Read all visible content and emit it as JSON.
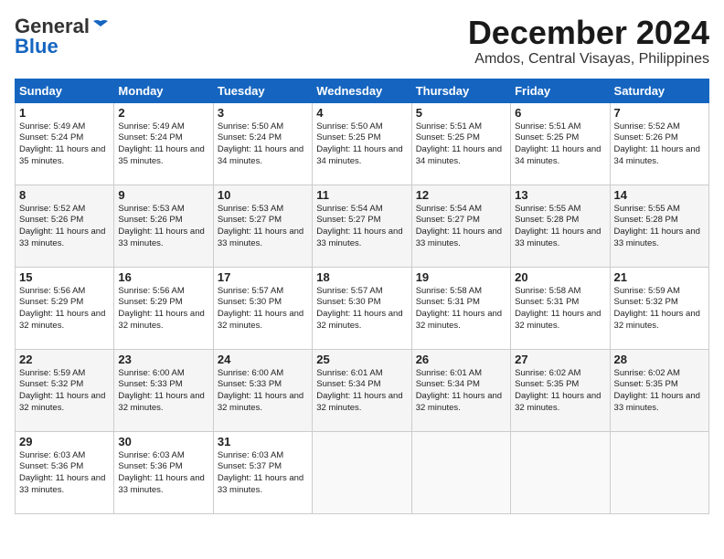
{
  "logo": {
    "line1": "General",
    "line2": "Blue"
  },
  "title": "December 2024",
  "location": "Amdos, Central Visayas, Philippines",
  "days_of_week": [
    "Sunday",
    "Monday",
    "Tuesday",
    "Wednesday",
    "Thursday",
    "Friday",
    "Saturday"
  ],
  "weeks": [
    [
      {
        "day": "1",
        "sunrise": "5:49 AM",
        "sunset": "5:24 PM",
        "daylight": "11 hours and 35 minutes."
      },
      {
        "day": "2",
        "sunrise": "5:49 AM",
        "sunset": "5:24 PM",
        "daylight": "11 hours and 35 minutes."
      },
      {
        "day": "3",
        "sunrise": "5:50 AM",
        "sunset": "5:24 PM",
        "daylight": "11 hours and 34 minutes."
      },
      {
        "day": "4",
        "sunrise": "5:50 AM",
        "sunset": "5:25 PM",
        "daylight": "11 hours and 34 minutes."
      },
      {
        "day": "5",
        "sunrise": "5:51 AM",
        "sunset": "5:25 PM",
        "daylight": "11 hours and 34 minutes."
      },
      {
        "day": "6",
        "sunrise": "5:51 AM",
        "sunset": "5:25 PM",
        "daylight": "11 hours and 34 minutes."
      },
      {
        "day": "7",
        "sunrise": "5:52 AM",
        "sunset": "5:26 PM",
        "daylight": "11 hours and 34 minutes."
      }
    ],
    [
      {
        "day": "8",
        "sunrise": "5:52 AM",
        "sunset": "5:26 PM",
        "daylight": "11 hours and 33 minutes."
      },
      {
        "day": "9",
        "sunrise": "5:53 AM",
        "sunset": "5:26 PM",
        "daylight": "11 hours and 33 minutes."
      },
      {
        "day": "10",
        "sunrise": "5:53 AM",
        "sunset": "5:27 PM",
        "daylight": "11 hours and 33 minutes."
      },
      {
        "day": "11",
        "sunrise": "5:54 AM",
        "sunset": "5:27 PM",
        "daylight": "11 hours and 33 minutes."
      },
      {
        "day": "12",
        "sunrise": "5:54 AM",
        "sunset": "5:27 PM",
        "daylight": "11 hours and 33 minutes."
      },
      {
        "day": "13",
        "sunrise": "5:55 AM",
        "sunset": "5:28 PM",
        "daylight": "11 hours and 33 minutes."
      },
      {
        "day": "14",
        "sunrise": "5:55 AM",
        "sunset": "5:28 PM",
        "daylight": "11 hours and 33 minutes."
      }
    ],
    [
      {
        "day": "15",
        "sunrise": "5:56 AM",
        "sunset": "5:29 PM",
        "daylight": "11 hours and 32 minutes."
      },
      {
        "day": "16",
        "sunrise": "5:56 AM",
        "sunset": "5:29 PM",
        "daylight": "11 hours and 32 minutes."
      },
      {
        "day": "17",
        "sunrise": "5:57 AM",
        "sunset": "5:30 PM",
        "daylight": "11 hours and 32 minutes."
      },
      {
        "day": "18",
        "sunrise": "5:57 AM",
        "sunset": "5:30 PM",
        "daylight": "11 hours and 32 minutes."
      },
      {
        "day": "19",
        "sunrise": "5:58 AM",
        "sunset": "5:31 PM",
        "daylight": "11 hours and 32 minutes."
      },
      {
        "day": "20",
        "sunrise": "5:58 AM",
        "sunset": "5:31 PM",
        "daylight": "11 hours and 32 minutes."
      },
      {
        "day": "21",
        "sunrise": "5:59 AM",
        "sunset": "5:32 PM",
        "daylight": "11 hours and 32 minutes."
      }
    ],
    [
      {
        "day": "22",
        "sunrise": "5:59 AM",
        "sunset": "5:32 PM",
        "daylight": "11 hours and 32 minutes."
      },
      {
        "day": "23",
        "sunrise": "6:00 AM",
        "sunset": "5:33 PM",
        "daylight": "11 hours and 32 minutes."
      },
      {
        "day": "24",
        "sunrise": "6:00 AM",
        "sunset": "5:33 PM",
        "daylight": "11 hours and 32 minutes."
      },
      {
        "day": "25",
        "sunrise": "6:01 AM",
        "sunset": "5:34 PM",
        "daylight": "11 hours and 32 minutes."
      },
      {
        "day": "26",
        "sunrise": "6:01 AM",
        "sunset": "5:34 PM",
        "daylight": "11 hours and 32 minutes."
      },
      {
        "day": "27",
        "sunrise": "6:02 AM",
        "sunset": "5:35 PM",
        "daylight": "11 hours and 32 minutes."
      },
      {
        "day": "28",
        "sunrise": "6:02 AM",
        "sunset": "5:35 PM",
        "daylight": "11 hours and 33 minutes."
      }
    ],
    [
      {
        "day": "29",
        "sunrise": "6:03 AM",
        "sunset": "5:36 PM",
        "daylight": "11 hours and 33 minutes."
      },
      {
        "day": "30",
        "sunrise": "6:03 AM",
        "sunset": "5:36 PM",
        "daylight": "11 hours and 33 minutes."
      },
      {
        "day": "31",
        "sunrise": "6:03 AM",
        "sunset": "5:37 PM",
        "daylight": "11 hours and 33 minutes."
      },
      null,
      null,
      null,
      null
    ]
  ]
}
